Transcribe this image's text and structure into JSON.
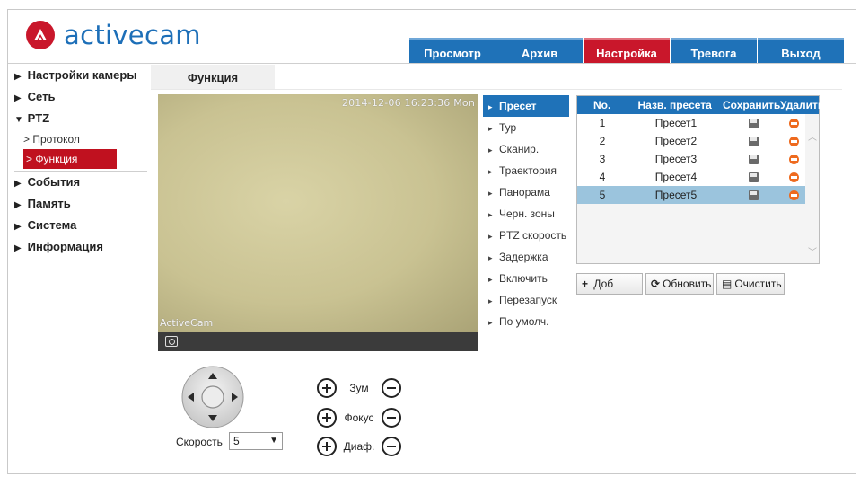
{
  "brand": {
    "name": "activecam",
    "logo_color": "#c9172b",
    "text_color": "#1d6fb8"
  },
  "topnav": {
    "tabs": [
      {
        "label": "Просмотр",
        "active": false
      },
      {
        "label": "Архив",
        "active": false
      },
      {
        "label": "Настройка",
        "active": true
      },
      {
        "label": "Тревога",
        "active": false
      },
      {
        "label": "Выход",
        "active": false
      }
    ],
    "accent": "#1f72b8",
    "active_color": "#c9172b"
  },
  "sidebar": {
    "items": [
      {
        "label": "Настройки камеры",
        "expanded": false
      },
      {
        "label": "Сеть",
        "expanded": false
      },
      {
        "label": "PTZ",
        "expanded": true
      },
      {
        "label": "События",
        "expanded": false
      },
      {
        "label": "Память",
        "expanded": false
      },
      {
        "label": "Система",
        "expanded": false
      },
      {
        "label": "Информация",
        "expanded": false
      }
    ],
    "ptz_sub": [
      {
        "label": "Протокол",
        "active": false
      },
      {
        "label": "Функция",
        "active": true
      }
    ],
    "collapsed_glyph": "▶",
    "expanded_glyph": "▼",
    "sub_glyph": ">"
  },
  "content": {
    "tab_label": "Функция"
  },
  "video": {
    "timestamp": "2014-12-06 16:23:36 Mon",
    "watermark": "ActiveCam",
    "snapshot_icon": "camera-icon"
  },
  "function_menu": {
    "items": [
      {
        "label": "Пресет",
        "active": true
      },
      {
        "label": "Тур",
        "active": false
      },
      {
        "label": "Сканир.",
        "active": false
      },
      {
        "label": "Траектория",
        "active": false
      },
      {
        "label": "Панорама",
        "active": false
      },
      {
        "label": "Черн. зоны",
        "active": false
      },
      {
        "label": "PTZ скорость",
        "active": false
      },
      {
        "label": "Задержка",
        "active": false
      },
      {
        "label": "Включить",
        "active": false
      },
      {
        "label": "Перезапуск",
        "active": false
      },
      {
        "label": "По умолч.",
        "active": false
      }
    ],
    "arrow": "▸"
  },
  "presets": {
    "headers": {
      "no": "No.",
      "name": "Назв. пресета",
      "save": "Сохранить",
      "delete": "Удалить"
    },
    "rows": [
      {
        "no": "1",
        "name": "Пресет1",
        "selected": false
      },
      {
        "no": "2",
        "name": "Пресет2",
        "selected": false
      },
      {
        "no": "3",
        "name": "Пресет3",
        "selected": false
      },
      {
        "no": "4",
        "name": "Пресет4",
        "selected": false
      },
      {
        "no": "5",
        "name": "Пресет5",
        "selected": true
      }
    ],
    "scroll_up": "︿",
    "scroll_down": "﹀"
  },
  "preset_actions": {
    "add": "Доб",
    "refresh": "Обновить",
    "clear": "Очистить",
    "add_glyph": "+",
    "refresh_glyph": "⟳",
    "clear_glyph": "▤"
  },
  "ptz": {
    "speed_label": "Скорость",
    "speed_value": "5",
    "speed_chevron": "▼",
    "zoom_label": "Зум",
    "focus_label": "Фокус",
    "iris_label": "Диаф."
  }
}
